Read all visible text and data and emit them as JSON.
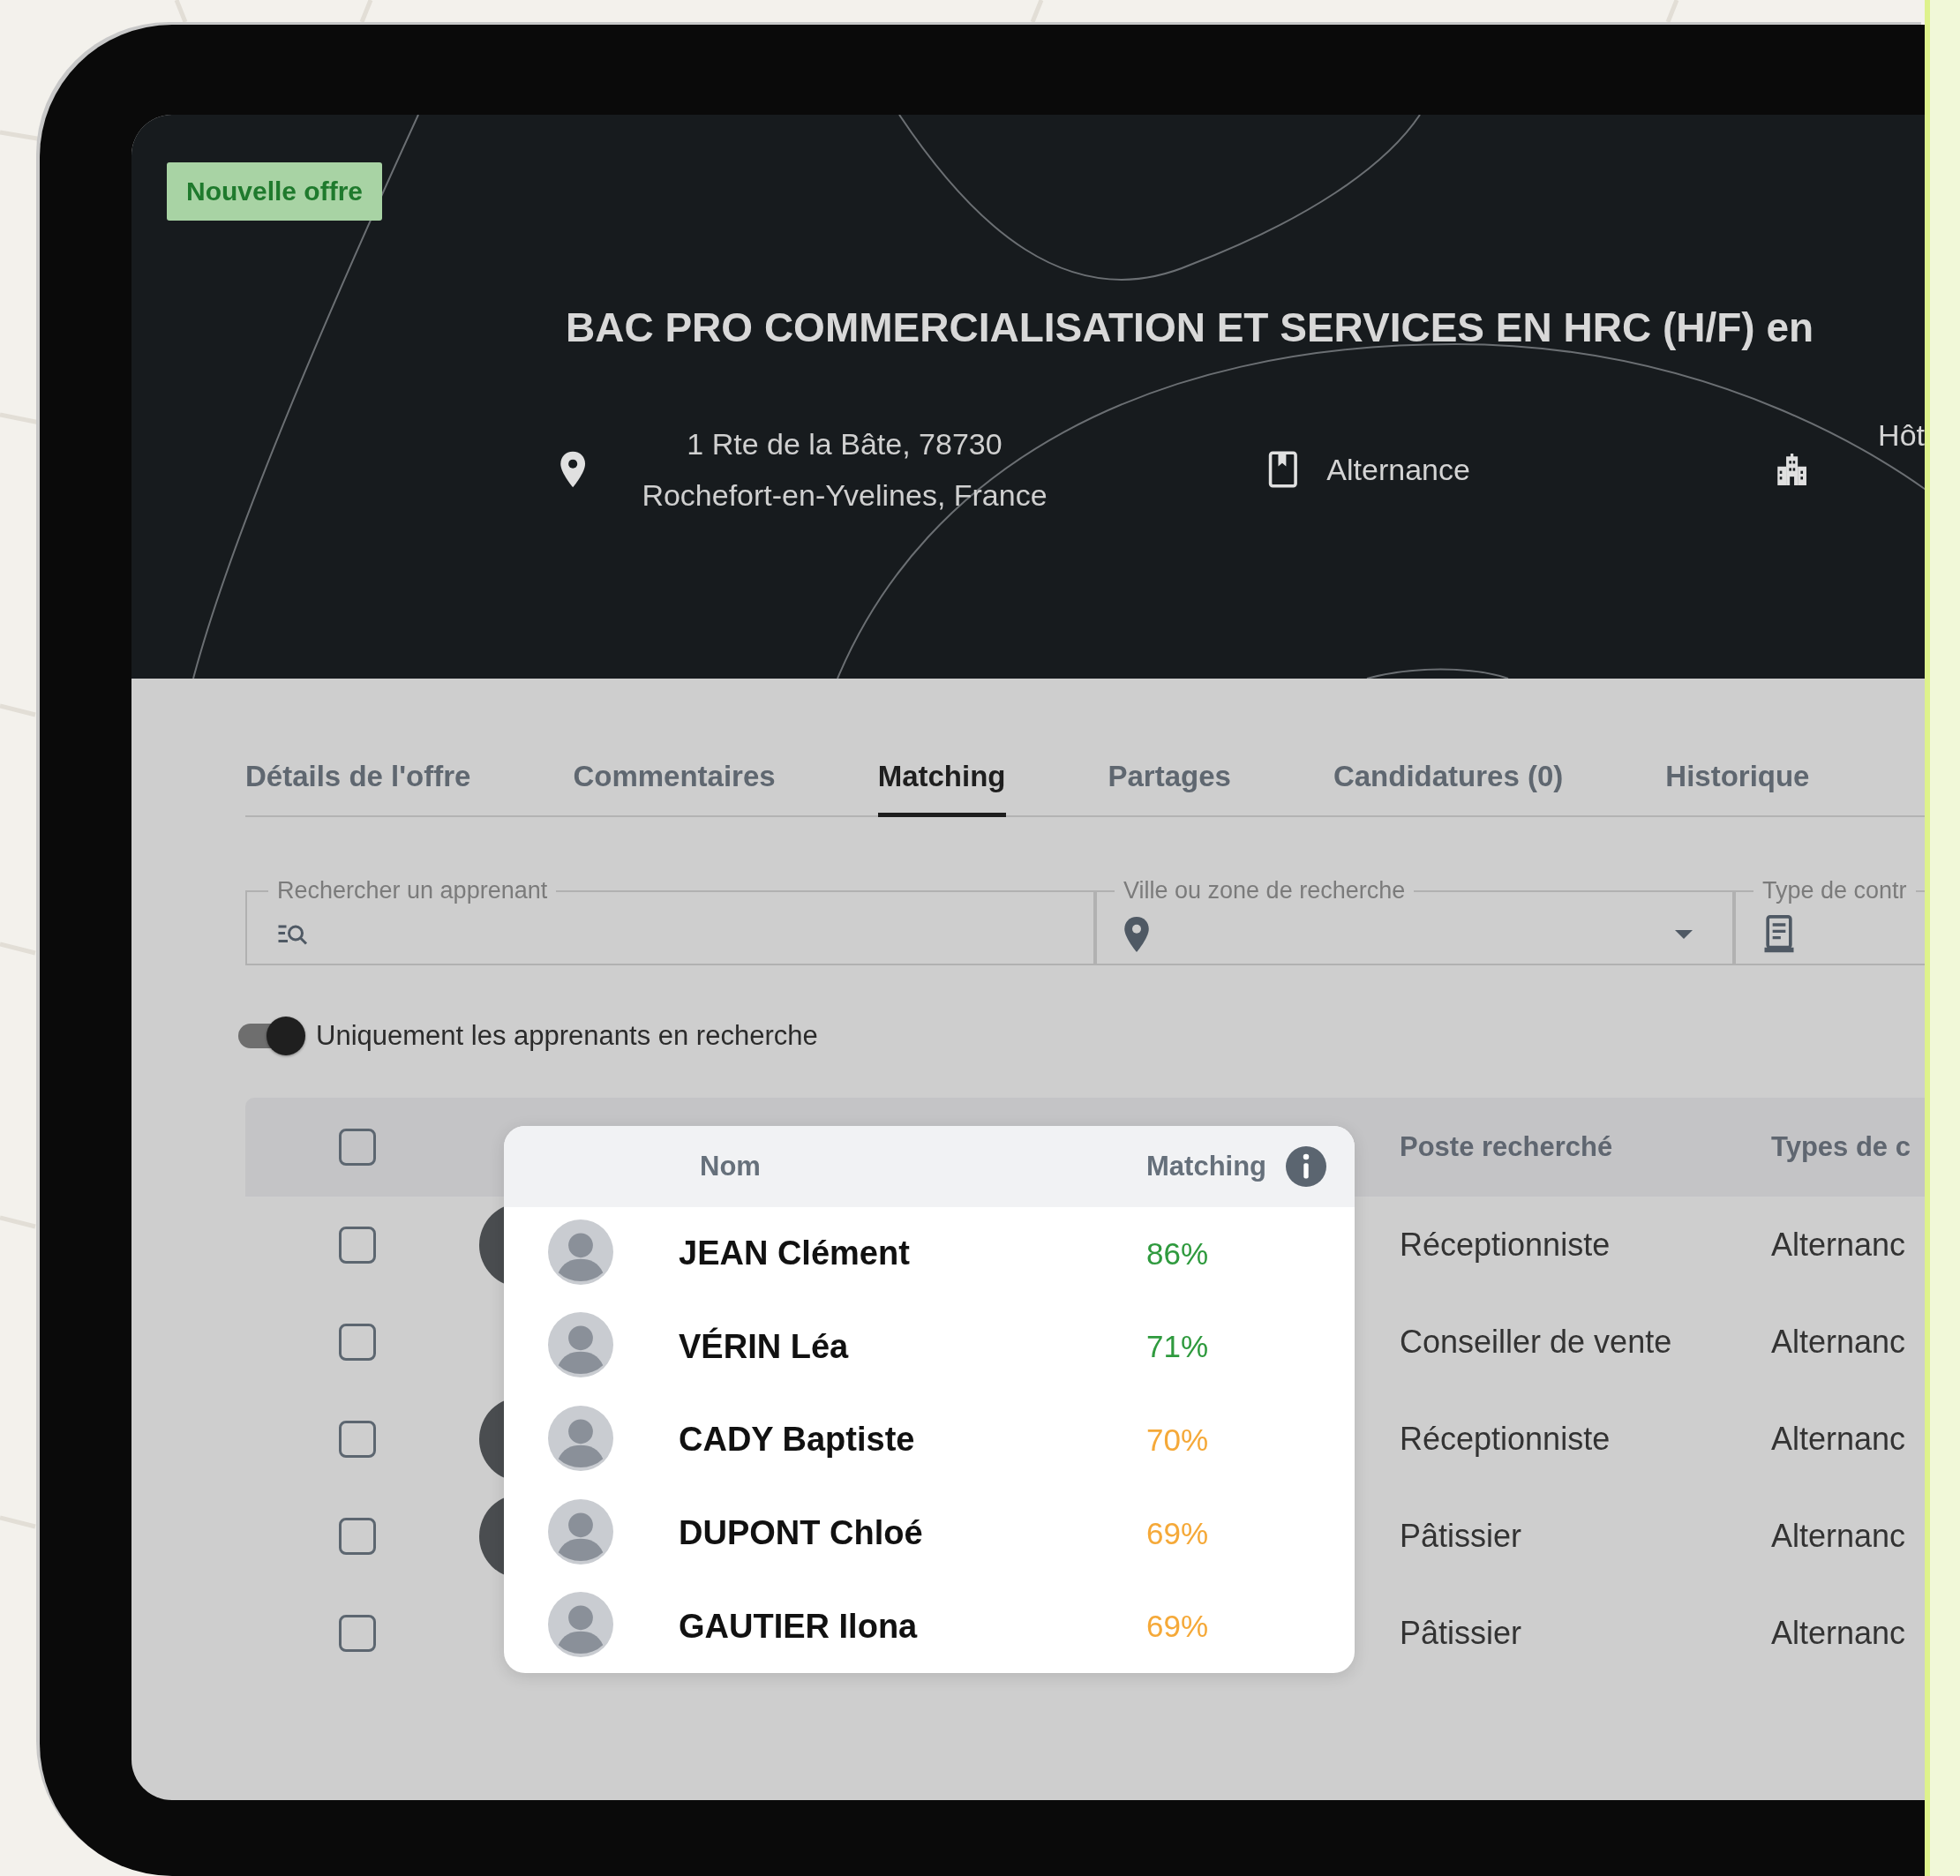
{
  "badge": "Nouvelle offre",
  "title": "BAC PRO COMMERCIALISATION ET SERVICES EN HRC (H/F) en",
  "address_lines": [
    "1 Rte de la Bâte, 78730",
    "Rochefort-en-Yvelines, France"
  ],
  "contract": "Alternance",
  "sector": "Hôt",
  "tabs": [
    {
      "label": "Détails de l'offre",
      "selected": false
    },
    {
      "label": "Commentaires",
      "selected": false
    },
    {
      "label": "Matching",
      "selected": true
    },
    {
      "label": "Partages",
      "selected": false
    },
    {
      "label": "Candidatures (0)",
      "selected": false
    },
    {
      "label": "Historique",
      "selected": false
    }
  ],
  "filters": [
    {
      "kind": "search",
      "label": "Rechercher un apprenant"
    },
    {
      "kind": "location",
      "label": "Ville ou zone de recherche"
    },
    {
      "kind": "contract",
      "label": "Type de contr"
    }
  ],
  "toggle": {
    "label": "Uniquement les apprenants en recherche",
    "on": true
  },
  "table": {
    "header_checked": false,
    "columns": [
      "Poste recherché",
      "Types de c"
    ],
    "rows": [
      {
        "checked": false,
        "photo": true,
        "position": "Réceptionniste",
        "type": "Alternanc"
      },
      {
        "checked": false,
        "photo": false,
        "position": "Conseiller de vente",
        "type": "Alternanc"
      },
      {
        "checked": false,
        "photo": true,
        "position": "Réceptionniste",
        "type": "Alternanc"
      },
      {
        "checked": false,
        "photo": true,
        "position": "Pâtissier",
        "type": "Alternanc"
      },
      {
        "checked": false,
        "photo": false,
        "position": "Pâtissier",
        "type": "Alternanc"
      }
    ]
  },
  "matching_card": {
    "columns": [
      "Nom",
      "Matching"
    ],
    "rows": [
      {
        "name": "JEAN Clément",
        "score": "86%",
        "color": "#2f9a3e"
      },
      {
        "name": "VÉRIN Léa",
        "score": "71%",
        "color": "#2f9a3e"
      },
      {
        "name": "CADY Baptiste",
        "score": "70%",
        "color": "#f5a939"
      },
      {
        "name": "DUPONT Chloé",
        "score": "69%",
        "color": "#f5a939"
      },
      {
        "name": "GAUTIER Ilona",
        "score": "69%",
        "color": "#f5a939"
      }
    ]
  }
}
